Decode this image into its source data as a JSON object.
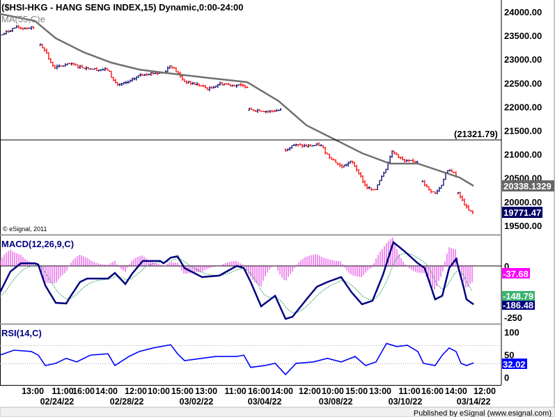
{
  "chart_data": [
    {
      "type": "ohlc",
      "title": "($HSI-HKG - HANG SENG INDEX,15) Dynamic,0:00-24:00",
      "overlay_label": "MA(55,C)e",
      "copyright": "© eSignal, 2011",
      "x_unit": "15-minute bar index",
      "y_ticks": [
        "24000.00",
        "23500.00",
        "23000.00",
        "22500.00",
        "22000.00",
        "21500.00",
        "21000.00",
        "20500.00",
        "20000.00",
        "19500.00"
      ],
      "ylim": [
        19400,
        24250
      ],
      "horizontal_line": {
        "value": 21321.79,
        "label": "(21321.79)"
      },
      "last_ma_label": "20338.1329",
      "last_price_label": "19771.47",
      "close_sessions": [
        [
          [
            1,
            23516
          ],
          [
            6.7,
            23663
          ],
          [
            16.7,
            23663
          ]
        ],
        [
          [
            19.3,
            23296
          ],
          [
            21.7,
            23194
          ],
          [
            24,
            22930
          ],
          [
            26.7,
            22827
          ],
          [
            33.3,
            22900
          ],
          [
            40,
            22827
          ],
          [
            46.7,
            22783
          ],
          [
            51.7,
            22783
          ],
          [
            54,
            22563
          ],
          [
            56.7,
            22460
          ],
          [
            61.7,
            22519
          ],
          [
            66.7,
            22666
          ],
          [
            71.7,
            22710
          ],
          [
            78.3,
            22710
          ],
          [
            81.7,
            22886
          ],
          [
            85,
            22710
          ],
          [
            88.3,
            22534
          ],
          [
            95,
            22460
          ],
          [
            100,
            22372
          ],
          [
            105,
            22490
          ],
          [
            111.7,
            22460
          ],
          [
            118.3,
            22431
          ]
        ],
        [
          [
            119.3,
            21933
          ],
          [
            123.3,
            21933
          ],
          [
            128.3,
            21903
          ],
          [
            135,
            21933
          ]
        ],
        [
          [
            136.7,
            21097
          ],
          [
            140,
            21199
          ],
          [
            146.7,
            21170
          ],
          [
            153.3,
            21199
          ],
          [
            156.7,
            20994
          ],
          [
            163.3,
            20730
          ],
          [
            168.3,
            20848
          ],
          [
            171.7,
            20613
          ],
          [
            175,
            20320
          ],
          [
            179.3,
            20217
          ],
          [
            181.7,
            20466
          ],
          [
            185,
            20730
          ],
          [
            187.3,
            21053
          ],
          [
            190,
            20994
          ],
          [
            193.3,
            20848
          ],
          [
            200,
            20848
          ]
        ],
        [
          [
            202.3,
            20437
          ],
          [
            205,
            20261
          ],
          [
            208.3,
            20173
          ],
          [
            211,
            20320
          ],
          [
            213.3,
            20613
          ],
          [
            216,
            20657
          ],
          [
            218.3,
            20554
          ]
        ],
        [
          [
            219.3,
            20173
          ],
          [
            221.7,
            19997
          ],
          [
            224,
            19821
          ],
          [
            226.7,
            19762
          ]
        ]
      ],
      "ma55": [
        [
          0,
          23956
        ],
        [
          16.7,
          23809
        ],
        [
          26.7,
          23443
        ],
        [
          40,
          23150
        ],
        [
          53.3,
          22930
        ],
        [
          66.7,
          22783
        ],
        [
          80,
          22710
        ],
        [
          100,
          22607
        ],
        [
          118.3,
          22519
        ],
        [
          133.3,
          22123
        ],
        [
          146.7,
          21610
        ],
        [
          160,
          21317
        ],
        [
          173.3,
          21023
        ],
        [
          186.7,
          20804
        ],
        [
          200,
          20804
        ],
        [
          210,
          20657
        ],
        [
          220,
          20510
        ],
        [
          226.7,
          20334
        ]
      ],
      "colors": {
        "up": "#000066",
        "down": "#ff0000",
        "ma": "#707070"
      }
    },
    {
      "type": "line",
      "title": "MACD(12,26,9,C)",
      "y_ticks": [
        "0",
        "-250"
      ],
      "ylim": [
        -300,
        150
      ],
      "macd": [
        [
          0,
          -128
        ],
        [
          5,
          -27
        ],
        [
          10,
          13
        ],
        [
          16.7,
          13
        ],
        [
          18.3,
          7
        ],
        [
          21.7,
          -95
        ],
        [
          26.7,
          -179
        ],
        [
          31.7,
          -182
        ],
        [
          33.3,
          -155
        ],
        [
          38.3,
          -78
        ],
        [
          41.7,
          -61
        ],
        [
          51.7,
          -61
        ],
        [
          55,
          -34
        ],
        [
          60,
          -88
        ],
        [
          63.3,
          -37
        ],
        [
          68.3,
          24
        ],
        [
          76.7,
          24
        ],
        [
          78.3,
          13
        ],
        [
          81.7,
          40
        ],
        [
          85,
          47
        ],
        [
          88.3,
          -10
        ],
        [
          96.7,
          -54
        ],
        [
          105,
          -47
        ],
        [
          113.3,
          0
        ],
        [
          116.7,
          -10
        ],
        [
          120,
          -78
        ],
        [
          125,
          -196
        ],
        [
          131.7,
          -145
        ],
        [
          136.7,
          -257
        ],
        [
          140,
          -247
        ],
        [
          146.7,
          -162
        ],
        [
          151.7,
          -101
        ],
        [
          156.7,
          -78
        ],
        [
          163.3,
          -54
        ],
        [
          168.3,
          -128
        ],
        [
          173.3,
          -186
        ],
        [
          178.3,
          -169
        ],
        [
          183.3,
          -44
        ],
        [
          188.3,
          115
        ],
        [
          193.3,
          74
        ],
        [
          200,
          13
        ],
        [
          203.3,
          -10
        ],
        [
          208.3,
          -162
        ],
        [
          211.7,
          -145
        ],
        [
          215,
          -10
        ],
        [
          218.3,
          34
        ],
        [
          221.7,
          -95
        ],
        [
          223.3,
          -162
        ],
        [
          226.7,
          -186.48
        ]
      ],
      "labels": {
        "histogram": "-37.68",
        "signal": "-148.79",
        "macd": "-186.48"
      },
      "colors": {
        "macd": "#000080",
        "signal": "#2e9e6a",
        "histogram": "#e020e0"
      }
    },
    {
      "type": "line",
      "title": "RSI(14,C)",
      "y_ticks": [
        "100",
        "50",
        "0"
      ],
      "ylim": [
        0,
        100
      ],
      "guides": [
        70,
        30
      ],
      "rsi": [
        [
          0,
          49
        ],
        [
          6.7,
          60
        ],
        [
          15,
          57
        ],
        [
          18.3,
          49
        ],
        [
          21.7,
          26
        ],
        [
          26.7,
          31
        ],
        [
          31.7,
          42
        ],
        [
          36.7,
          34
        ],
        [
          43.3,
          49
        ],
        [
          51.7,
          52
        ],
        [
          55,
          26
        ],
        [
          61.7,
          46
        ],
        [
          66.7,
          57
        ],
        [
          73.3,
          65
        ],
        [
          81.7,
          72
        ],
        [
          85,
          52
        ],
        [
          88.3,
          37
        ],
        [
          96.7,
          42
        ],
        [
          103.3,
          46
        ],
        [
          113.3,
          46
        ],
        [
          116.7,
          49
        ],
        [
          120,
          22
        ],
        [
          126.7,
          26
        ],
        [
          131.7,
          31
        ],
        [
          136.7,
          6
        ],
        [
          141.7,
          31
        ],
        [
          150,
          34
        ],
        [
          156.7,
          42
        ],
        [
          163.3,
          34
        ],
        [
          170,
          46
        ],
        [
          175,
          26
        ],
        [
          180,
          34
        ],
        [
          185,
          75
        ],
        [
          190,
          68
        ],
        [
          195,
          71
        ],
        [
          200,
          57
        ],
        [
          202.7,
          31
        ],
        [
          208.3,
          26
        ],
        [
          211.7,
          49
        ],
        [
          215,
          65
        ],
        [
          218.3,
          57
        ],
        [
          220.7,
          31
        ],
        [
          223.3,
          26
        ],
        [
          226.7,
          32.02
        ]
      ],
      "last_label": "32.02",
      "color": "#0000ff"
    }
  ],
  "x_axis": {
    "times": [
      [
        "13:00",
        15.7
      ],
      [
        "11:00",
        30
      ],
      [
        "16:00",
        40
      ],
      [
        "14:00",
        51
      ],
      [
        "12:00",
        65
      ],
      [
        "10:00",
        76
      ],
      [
        "15:00",
        87.3
      ],
      [
        "13:00",
        98.7
      ],
      [
        "11:00",
        112.7
      ],
      [
        "16:00",
        124
      ],
      [
        "14:00",
        135
      ],
      [
        "12:00",
        148.3
      ],
      [
        "10:00",
        159.3
      ],
      [
        "15:00",
        170.7
      ],
      [
        "13:00",
        182
      ],
      [
        "11:00",
        196
      ],
      [
        "16:00",
        207
      ],
      [
        "14:00",
        218.3
      ],
      [
        "12:00",
        232
      ]
    ],
    "dates": [
      [
        "02/24/22",
        27.3
      ],
      [
        "02/28/22",
        60.7
      ],
      [
        "03/02/22",
        94
      ],
      [
        "03/04/22",
        126.7
      ],
      [
        "03/08/22",
        160.7
      ],
      [
        "03/10/22",
        194
      ],
      [
        "03/14/22",
        226.7
      ]
    ]
  },
  "footer": {
    "published": "Published by eSignal (www.esignal.com)"
  }
}
